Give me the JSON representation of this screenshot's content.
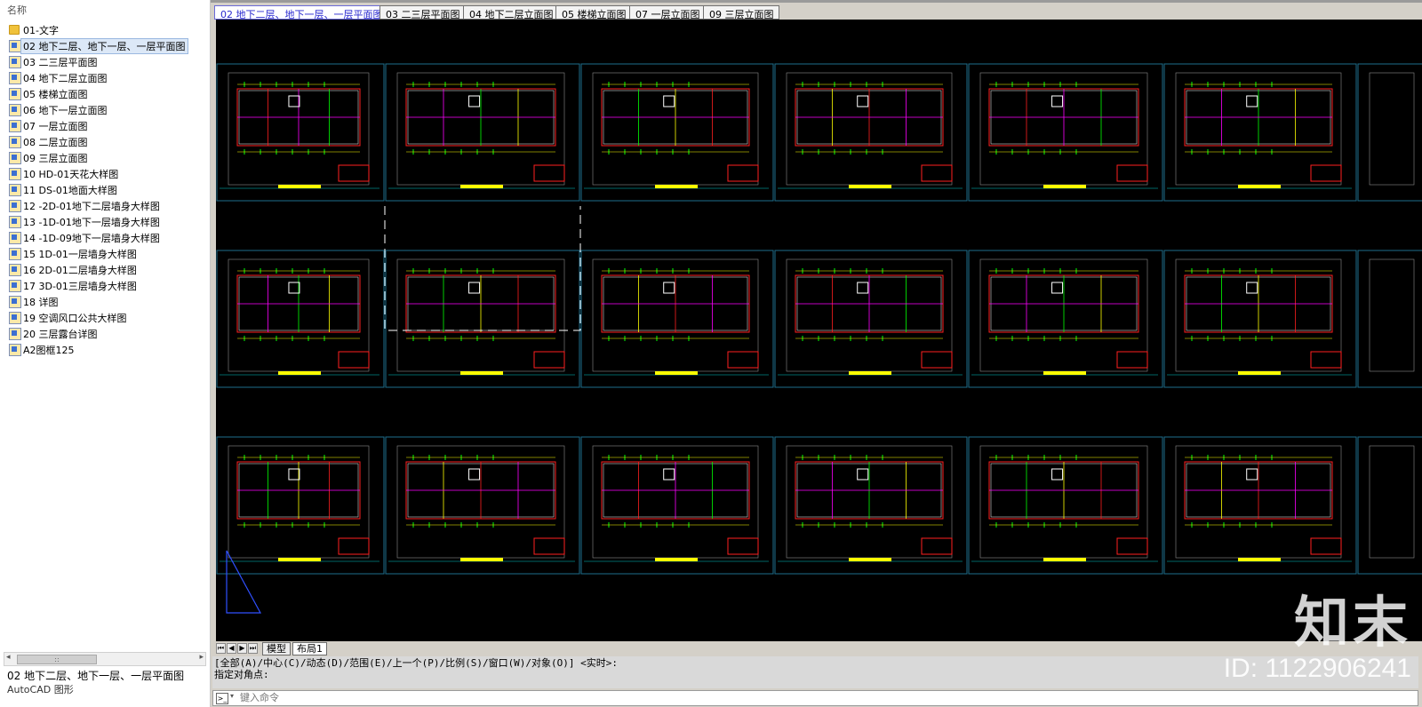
{
  "left_panel": {
    "header_label": "名称",
    "items": [
      {
        "label": "01-文字",
        "type": "folder",
        "selected": false
      },
      {
        "label": "02 地下二层、地下一层、一层平面图",
        "type": "dwg",
        "selected": true
      },
      {
        "label": "03 二三层平面图",
        "type": "dwg",
        "selected": false
      },
      {
        "label": "04 地下二层立面图",
        "type": "dwg",
        "selected": false
      },
      {
        "label": "05 楼梯立面图",
        "type": "dwg",
        "selected": false
      },
      {
        "label": "06 地下一层立面图",
        "type": "dwg",
        "selected": false
      },
      {
        "label": "07 一层立面图",
        "type": "dwg",
        "selected": false
      },
      {
        "label": "08 二层立面图",
        "type": "dwg",
        "selected": false
      },
      {
        "label": "09 三层立面图",
        "type": "dwg",
        "selected": false
      },
      {
        "label": "10 HD-01天花大样图",
        "type": "dwg",
        "selected": false
      },
      {
        "label": "11 DS-01地面大样图",
        "type": "dwg",
        "selected": false
      },
      {
        "label": "12 -2D-01地下二层墙身大样图",
        "type": "dwg",
        "selected": false
      },
      {
        "label": "13 -1D-01地下一层墙身大样图",
        "type": "dwg",
        "selected": false
      },
      {
        "label": "14 -1D-09地下一层墙身大样图",
        "type": "dwg",
        "selected": false
      },
      {
        "label": "15 1D-01一层墙身大样图",
        "type": "dwg",
        "selected": false
      },
      {
        "label": "16 2D-01二层墙身大样图",
        "type": "dwg",
        "selected": false
      },
      {
        "label": "17 3D-01三层墙身大样图",
        "type": "dwg",
        "selected": false
      },
      {
        "label": "18 详图",
        "type": "dwg",
        "selected": false
      },
      {
        "label": "19 空调风口公共大样图",
        "type": "dwg",
        "selected": false
      },
      {
        "label": "20 三层露台详图",
        "type": "dwg",
        "selected": false
      },
      {
        "label": "A2图框125",
        "type": "dwg",
        "selected": false
      }
    ],
    "scroll_label": "::",
    "status_title": "02 地下二层、地下一层、一层平面图",
    "status_type": "AutoCAD 图形"
  },
  "doc_tabs": [
    {
      "label": "02 地下二层、地下一层、一层平面图",
      "active": true
    },
    {
      "label": "03 二三层平面图",
      "active": false
    },
    {
      "label": "04 地下二层立面图",
      "active": false
    },
    {
      "label": "05 楼梯立面图",
      "active": false
    },
    {
      "label": "07 一层立面图",
      "active": false
    },
    {
      "label": "09 三层立面图",
      "active": false
    }
  ],
  "layout_tabs": {
    "model": "模型",
    "layout1": "布局1"
  },
  "command": {
    "history_line1": "[全部(A)/中心(C)/动态(D)/范围(E)/上一个(P)/比例(S)/窗口(W)/对象(O)] <实时>:",
    "history_line2": "指定对角点:",
    "placeholder": "键入命令"
  },
  "watermark": {
    "logo": "知末",
    "id": "ID: 1122906241"
  },
  "colors": {
    "canvas_bg": "#000000",
    "frame": "#1e6e8c",
    "accent_yellow": "#ffff00",
    "accent_red": "#ff2020",
    "accent_magenta": "#ff00ff",
    "accent_green": "#00ff00"
  }
}
